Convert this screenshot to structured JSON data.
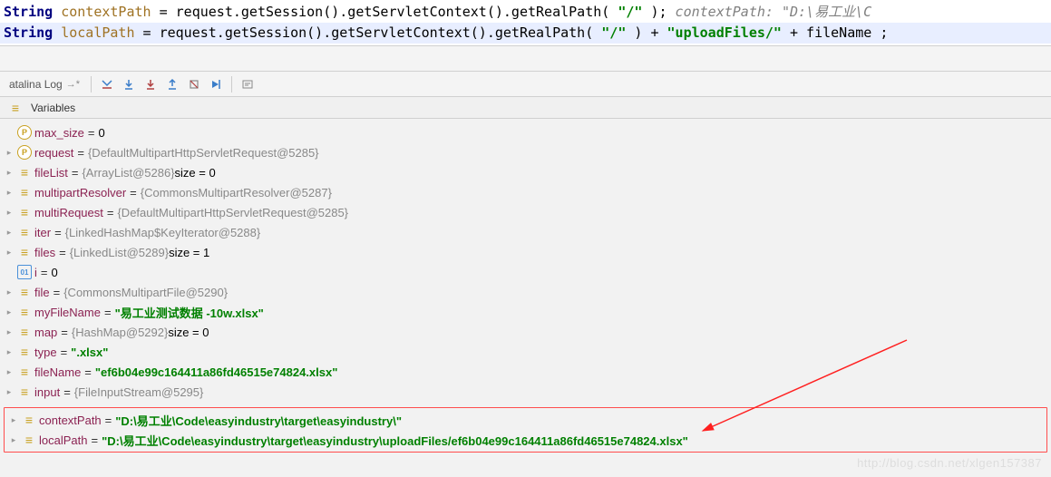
{
  "code": {
    "line1": {
      "type": "String",
      "varName": "contextPath",
      "expr": " = request.getSession().getServletContext().getRealPath(",
      "arg": "\"/\"",
      "end": ");",
      "commentLabel": "  contextPath: ",
      "commentValue": "\"D:\\易工业\\C"
    },
    "line2": {
      "type": "String",
      "varName": "localPath",
      "expr": " = request.getSession().getServletContext().getRealPath(",
      "arg": "\"/\"",
      "mid": ") + ",
      "str2": "\"uploadFiles/\"",
      "mid2": " + fileName;",
      "fileName": "fileName"
    }
  },
  "toolbar": {
    "tab": "atalina Log"
  },
  "panel": {
    "title": "Variables"
  },
  "vars": [
    {
      "arrow": "",
      "icon": "p",
      "name": "max_size",
      "eq": " = ",
      "val": "0",
      "valClass": "black"
    },
    {
      "arrow": "▸",
      "icon": "p",
      "name": "request",
      "eq": " = ",
      "val": "{DefaultMultipartHttpServletRequest@5285}",
      "valClass": "gray"
    },
    {
      "arrow": "▸",
      "icon": "obj",
      "name": "fileList",
      "eq": " = ",
      "val": "{ArrayList@5286}",
      "valClass": "gray",
      "extra": "  size = 0"
    },
    {
      "arrow": "▸",
      "icon": "obj",
      "name": "multipartResolver",
      "eq": " = ",
      "val": "{CommonsMultipartResolver@5287}",
      "valClass": "gray"
    },
    {
      "arrow": "▸",
      "icon": "obj",
      "name": "multiRequest",
      "eq": " = ",
      "val": "{DefaultMultipartHttpServletRequest@5285}",
      "valClass": "gray"
    },
    {
      "arrow": "▸",
      "icon": "obj",
      "name": "iter",
      "eq": " = ",
      "val": "{LinkedHashMap$KeyIterator@5288}",
      "valClass": "gray"
    },
    {
      "arrow": "▸",
      "icon": "obj",
      "name": "files",
      "eq": " = ",
      "val": "{LinkedList@5289}",
      "valClass": "gray",
      "extra": "  size = 1"
    },
    {
      "arrow": "",
      "icon": "num",
      "name": "i",
      "eq": " = ",
      "val": "0",
      "valClass": "black"
    },
    {
      "arrow": "▸",
      "icon": "obj",
      "name": "file",
      "eq": " = ",
      "val": "{CommonsMultipartFile@5290}",
      "valClass": "gray"
    },
    {
      "arrow": "▸",
      "icon": "obj",
      "name": "myFileName",
      "eq": " = ",
      "val": "\"易工业测试数据 -10w.xlsx\"",
      "valClass": "green"
    },
    {
      "arrow": "▸",
      "icon": "obj",
      "name": "map",
      "eq": " = ",
      "val": "{HashMap@5292}",
      "valClass": "gray",
      "extra": "  size = 0"
    },
    {
      "arrow": "▸",
      "icon": "obj",
      "name": "type",
      "eq": " = ",
      "val": "\".xlsx\"",
      "valClass": "green"
    },
    {
      "arrow": "▸",
      "icon": "obj",
      "name": "fileName",
      "eq": " = ",
      "val": "\"ef6b04e99c164411a86fd46515e74824.xlsx\"",
      "valClass": "green"
    },
    {
      "arrow": "▸",
      "icon": "obj",
      "name": "input",
      "eq": " = ",
      "val": "{FileInputStream@5295}",
      "valClass": "gray"
    }
  ],
  "highlighted": [
    {
      "arrow": "▸",
      "icon": "obj",
      "name": "contextPath",
      "eq": " = ",
      "val": "\"D:\\易工业\\Code\\easyindustry\\target\\easyindustry\\\"",
      "valClass": "green"
    },
    {
      "arrow": "▸",
      "icon": "obj",
      "name": "localPath",
      "eq": " = ",
      "val": "\"D:\\易工业\\Code\\easyindustry\\target\\easyindustry\\uploadFiles/ef6b04e99c164411a86fd46515e74824.xlsx\"",
      "valClass": "green"
    }
  ],
  "watermark": "http://blog.csdn.net/xlgen157387"
}
